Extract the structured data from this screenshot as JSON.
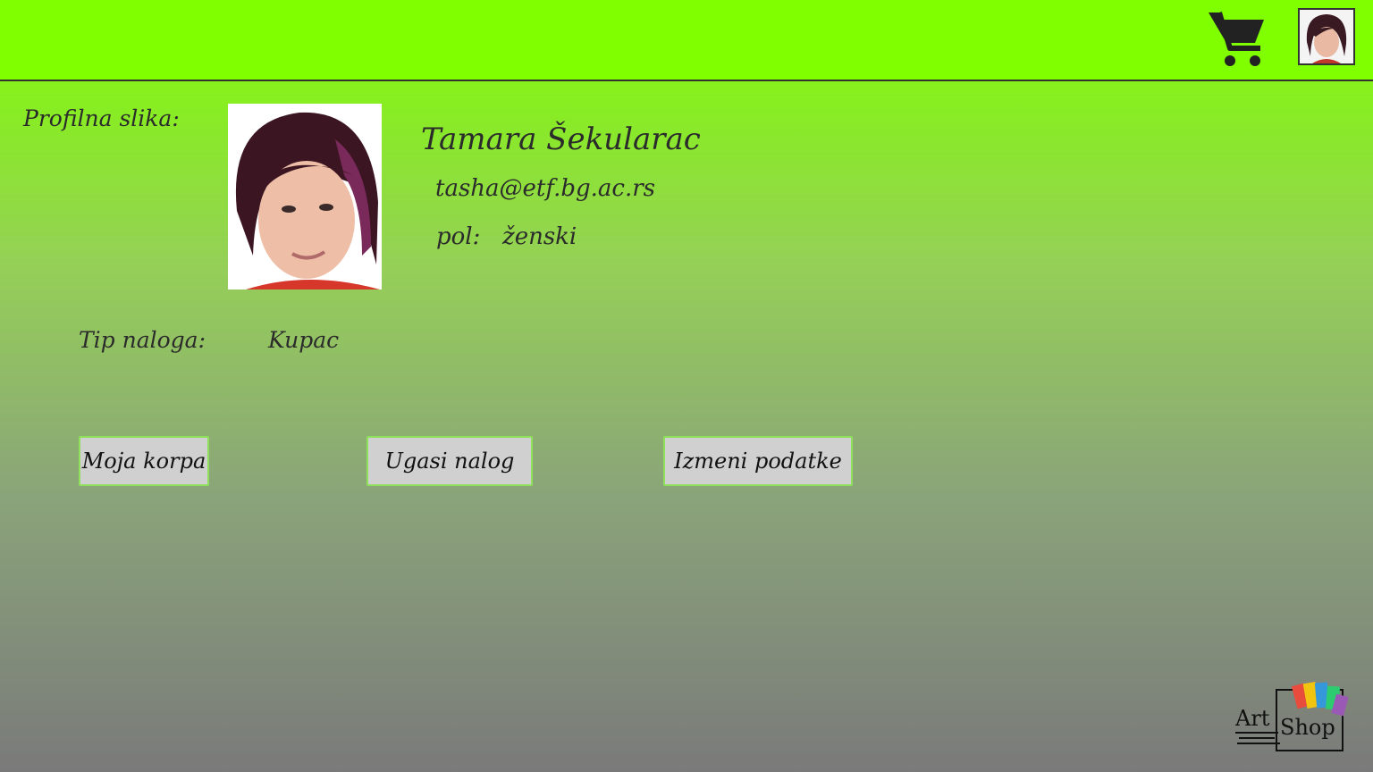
{
  "header": {
    "cart_icon": "shopping-cart-icon",
    "avatar_icon": "user-avatar-icon"
  },
  "profile": {
    "picture_label": "Profilna slika:",
    "name": "Tamara Šekularac",
    "email": "tasha@etf.bg.ac.rs",
    "gender_label": "pol:",
    "gender_value": "ženski",
    "account_type_label": "Tip naloga:",
    "account_type_value": "Kupac"
  },
  "actions": {
    "my_cart": "Moja korpa",
    "deactivate": "Ugasi nalog",
    "edit": "Izmeni podatke"
  },
  "logo": {
    "text_art": "Art",
    "text_shop": "Shop"
  },
  "colors": {
    "header_bg": "#7fff00",
    "button_bg": "#d0d0d0",
    "button_border": "#8fe05a"
  }
}
